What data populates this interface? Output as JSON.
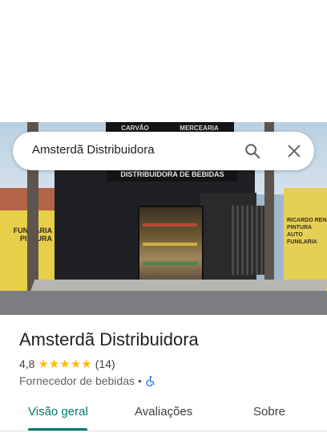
{
  "search": {
    "query": "Amsterdã Distribuidora",
    "search_icon": "search-icon",
    "close_icon": "close-icon"
  },
  "photo": {
    "banner_left": "CARVÃO",
    "banner_right": "MERCEARIA",
    "shop_sign": "DISTRIBUIDORA DE BEBIDAS",
    "left_sign": "FUNILARIA E PINTURA",
    "right_sign_line1": "RICARDO REN",
    "right_sign_line2": "PINTURA AUTO",
    "right_sign_line3": "FUNILARIA"
  },
  "place": {
    "name": "Amsterdã Distribuidora",
    "rating": "4,8",
    "stars": "★★★★★",
    "reviews": "(14)",
    "category": "Fornecedor de bebidas",
    "separator": "•",
    "accessibility_icon": "wheelchair-icon"
  },
  "tabs": [
    {
      "label": "Visão geral",
      "active": true
    },
    {
      "label": "Avaliações",
      "active": false
    },
    {
      "label": "Sobre",
      "active": false
    }
  ],
  "colors": {
    "accent": "#00796b",
    "star": "#fbbc04",
    "accessibility": "#1a73e8"
  }
}
